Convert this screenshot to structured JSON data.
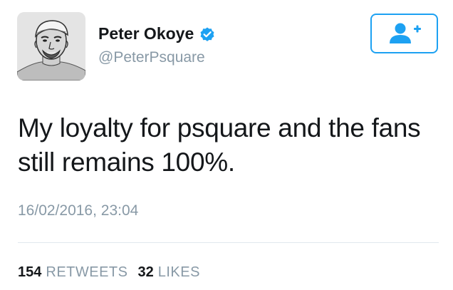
{
  "user": {
    "display_name": "Peter Okoye",
    "handle": "@PeterPsquare",
    "verified": true,
    "avatar_icon": "profile-photo-sketch"
  },
  "follow_button": {
    "icon": "add-user-icon",
    "color": "#1da1f2"
  },
  "tweet": {
    "text": "My loyalty for psquare and the fans still remains 100%.",
    "timestamp": "16/02/2016, 23:04"
  },
  "stats": {
    "retweets_count": "154",
    "retweets_label": "RETWEETS",
    "likes_count": "32",
    "likes_label": "LIKES"
  },
  "colors": {
    "accent": "#1da1f2",
    "secondary_text": "#8899a6",
    "primary_text": "#14171a"
  }
}
